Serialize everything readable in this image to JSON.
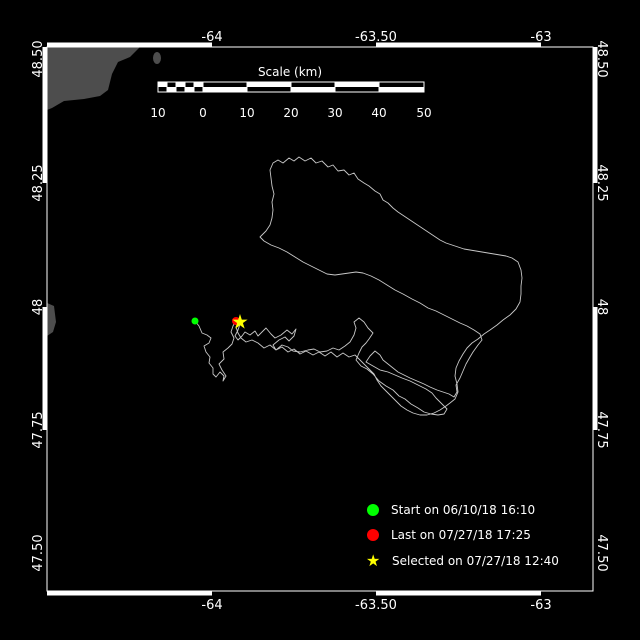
{
  "map": {
    "top_longitude_labels": [
      "-64",
      "-63.50",
      "-63"
    ],
    "bottom_longitude_labels": [
      "-64",
      "-63.50",
      "-63"
    ],
    "left_latitude_labels": [
      "48.50",
      "48.25",
      "48",
      "47.75",
      "47.50"
    ],
    "right_latitude_labels": [
      "48.50",
      "48.25",
      "48",
      "47.75",
      "47.50"
    ],
    "scale_title": "Scale (km)",
    "scale_ticks": [
      "10",
      "0",
      "10",
      "20",
      "30",
      "40",
      "50"
    ],
    "colors": {
      "background": "#000000",
      "land": "#4d4d4d",
      "track": "#c8c8c8",
      "start": "#00ff00",
      "last": "#ff0000",
      "selected": "#ffff00",
      "frame": "#ffffff"
    }
  },
  "legend": {
    "start_label": "Start on 06/10/18 16:10",
    "last_label": "Last on 07/27/18 17:25",
    "selected_label": "Selected on 07/27/18 12:40"
  }
}
